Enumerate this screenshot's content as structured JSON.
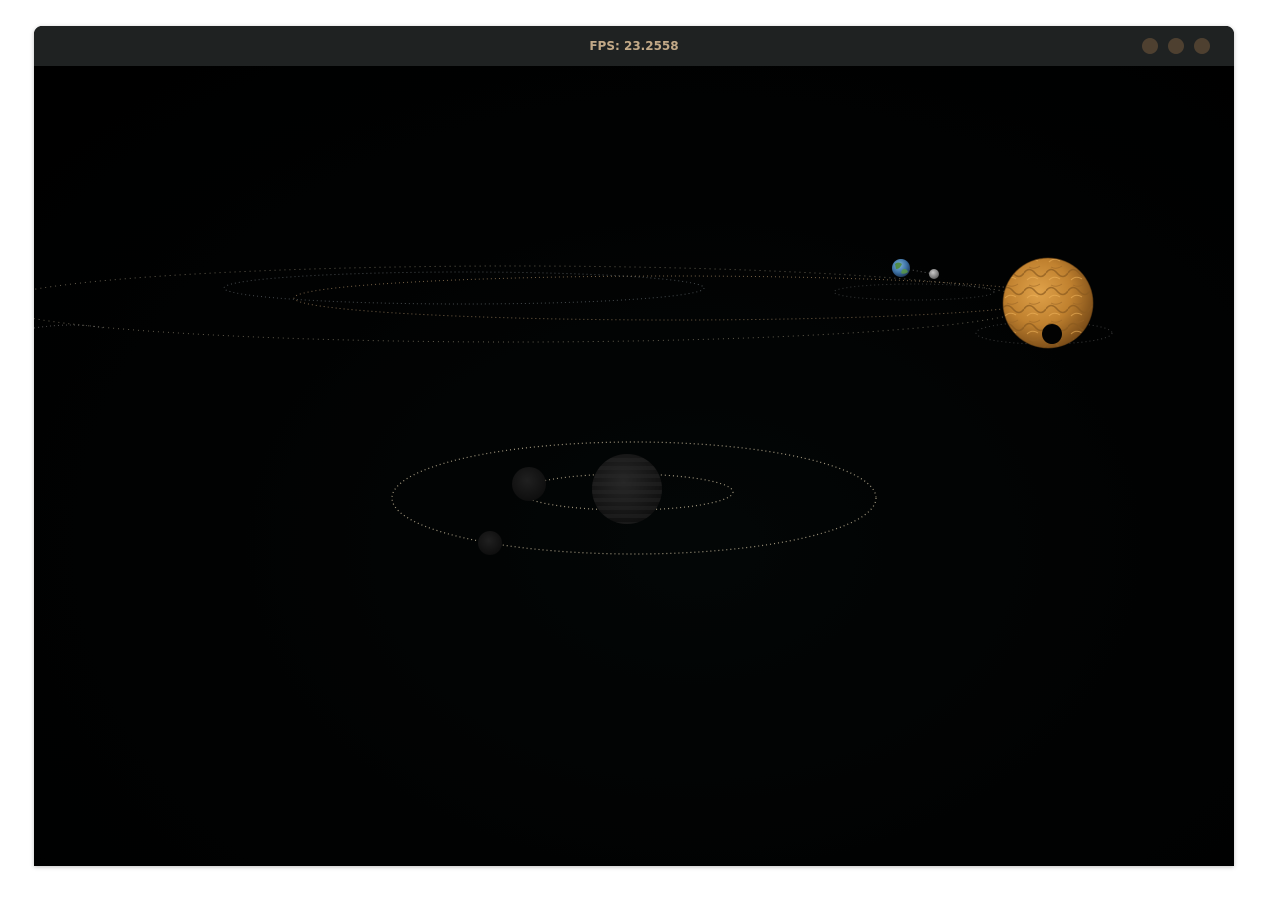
{
  "window": {
    "title": "FPS: 23.2558",
    "controls": [
      "minimize",
      "maximize",
      "close"
    ]
  },
  "scene": {
    "background": "#000000",
    "orbit_color": "#d8c9a8",
    "bodies": [
      {
        "name": "sun",
        "color": "#c88a35"
      },
      {
        "name": "earth",
        "color": "#3f7fbf"
      },
      {
        "name": "moon",
        "color": "#8a8a8a"
      },
      {
        "name": "dark-planet",
        "color": "#1e1e1e"
      },
      {
        "name": "dark-moon-inner",
        "color": "#151515"
      },
      {
        "name": "dark-moon-outer",
        "color": "#151515"
      }
    ]
  }
}
